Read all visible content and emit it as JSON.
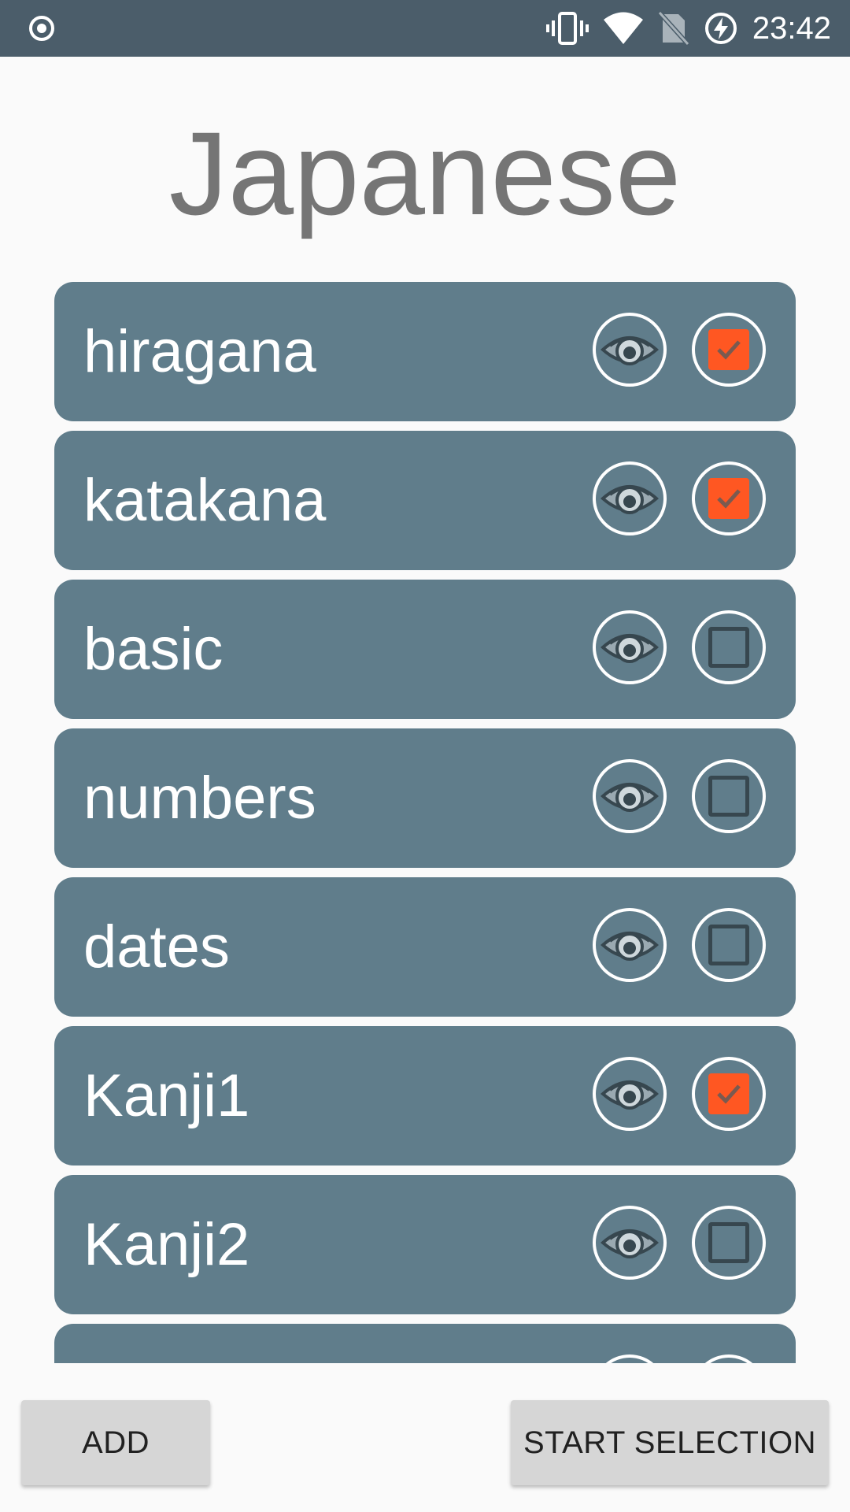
{
  "status_bar": {
    "time": "23:42",
    "icons": [
      "record-icon",
      "vibrate-icon",
      "wifi-icon",
      "no-sim-icon",
      "battery-charging-icon"
    ]
  },
  "page": {
    "title": "Japanese"
  },
  "list": {
    "items": [
      {
        "label": "hiragana",
        "checked": true
      },
      {
        "label": "katakana",
        "checked": true
      },
      {
        "label": "basic",
        "checked": false
      },
      {
        "label": "numbers",
        "checked": false
      },
      {
        "label": "dates",
        "checked": false
      },
      {
        "label": "Kanji1",
        "checked": true
      },
      {
        "label": "Kanji2",
        "checked": false
      },
      {
        "label": "",
        "checked": false
      }
    ]
  },
  "buttons": {
    "add": "ADD",
    "start_selection": "START SELECTION"
  },
  "colors": {
    "status_bar": "#4b5d6a",
    "item_background": "#607d8b",
    "checkbox_checked": "#ff5722",
    "title_text": "#757575",
    "button_background": "#d6d6d6"
  }
}
